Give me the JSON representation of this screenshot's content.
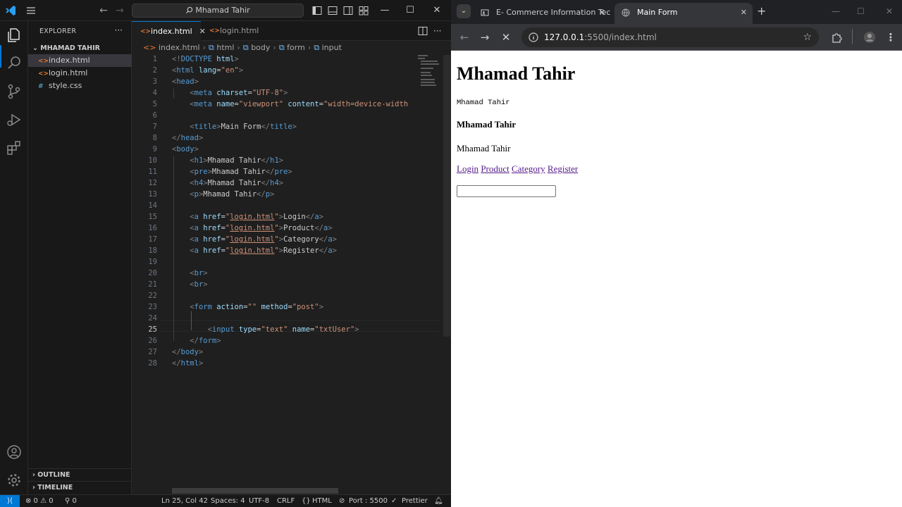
{
  "vscode": {
    "titlebar": {
      "search_text": "Mhamad Tahir"
    },
    "explorer": {
      "header": "EXPLORER",
      "folder": "MHAMAD TAHIR",
      "files": [
        "index.html",
        "login.html",
        "style.css"
      ],
      "outline": "OUTLINE",
      "timeline": "TIMELINE"
    },
    "tabs": [
      "index.html",
      "login.html"
    ],
    "breadcrumb": [
      "index.html",
      "html",
      "body",
      "form",
      "input"
    ],
    "line_numbers": [
      "1",
      "2",
      "3",
      "4",
      "5",
      "6",
      "7",
      "8",
      "9",
      "10",
      "11",
      "12",
      "13",
      "14",
      "15",
      "16",
      "17",
      "18",
      "19",
      "20",
      "21",
      "22",
      "23",
      "24",
      "25",
      "26",
      "27",
      "28"
    ],
    "code": {
      "l4_charset": "UTF-8",
      "l5_content": "width=device-width",
      "l7_title": "Main Form",
      "l10": "Mhamad Tahir",
      "l11": "Mhamad Tahir",
      "l12": "Mhamad Tahir",
      "l13": "Mhamad Tahir",
      "href": "login.html",
      "l15": "Login",
      "l16": "Product",
      "l17": "Category",
      "l18": "Register",
      "l23_method": "post",
      "l25_type": "text",
      "l25_name": "txtUser"
    },
    "status": {
      "problems": "⊗ 0 ⚠ 0",
      "ports": "⚲ 0",
      "position": "Ln 25, Col 42",
      "spaces": "Spaces: 4",
      "encoding": "UTF-8",
      "eol": "CRLF",
      "language": "HTML",
      "port": "Port : 5500",
      "prettier": "Prettier"
    }
  },
  "chrome": {
    "tabs": [
      {
        "title": "E- Commerce Information Tech"
      },
      {
        "title": "Main Form"
      }
    ],
    "address": {
      "host": "127.0.0.1",
      "path": ":5500/index.html"
    },
    "page": {
      "h1": "Mhamad Tahir",
      "pre": "Mhamad Tahir",
      "h4": "Mhamad Tahir",
      "p": "Mhamad Tahir",
      "links": [
        "Login",
        "Product",
        "Category",
        "Register"
      ]
    }
  },
  "colors": {
    "accent": "#0078d4",
    "link_visited": "#551a8b"
  }
}
